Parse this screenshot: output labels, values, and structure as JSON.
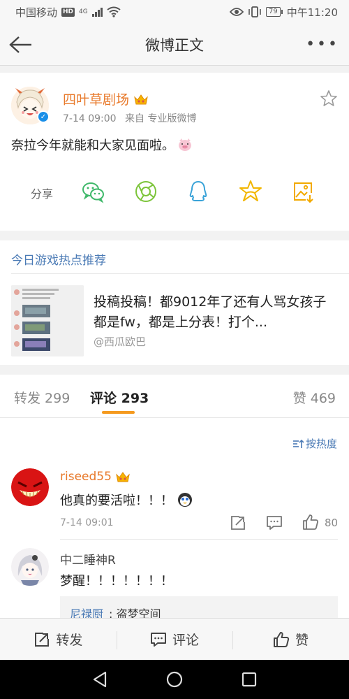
{
  "status_bar": {
    "carrier": "中国移动",
    "hd": "HD",
    "network": "4G",
    "battery": "79",
    "time": "中午11:20"
  },
  "header": {
    "title": "微博正文"
  },
  "post": {
    "author": "四叶草剧场",
    "date": "7-14 09:00",
    "source": "来自 专业版微博",
    "text": "奈拉今年就能和大家见面啦。",
    "share_label": "分享",
    "share_icons": [
      "wechat-icon",
      "moments-icon",
      "qq-icon",
      "qzone-icon",
      "save-image-icon"
    ]
  },
  "hot": {
    "title": "今日游戏热点推荐",
    "headline": "投稿投稿！都9012年了还有人骂女孩子都是fw，都是上分表！打个...",
    "source": "@西瓜欧巴"
  },
  "tabs": {
    "repost": "转发 299",
    "comment": "评论 293",
    "like": "赞 469"
  },
  "comments": {
    "sort_label": "按热度",
    "items": [
      {
        "name": "riseed55",
        "text": "他真的要活啦！！！",
        "time": "7-14 09:01",
        "likes": "80"
      },
      {
        "name": "中二睡神R",
        "text": "梦醒！！！！！！！",
        "reply_name": "尼禄厨",
        "reply_text": "_: 盗梦空间"
      }
    ]
  },
  "action_bar": {
    "repost": "转发",
    "comment": "评论",
    "like": "赞"
  },
  "colors": {
    "author": "#e8792a",
    "link": "#4a7ab5",
    "tab_underline": "#f59a1f",
    "verified": "#1a8fe8"
  }
}
